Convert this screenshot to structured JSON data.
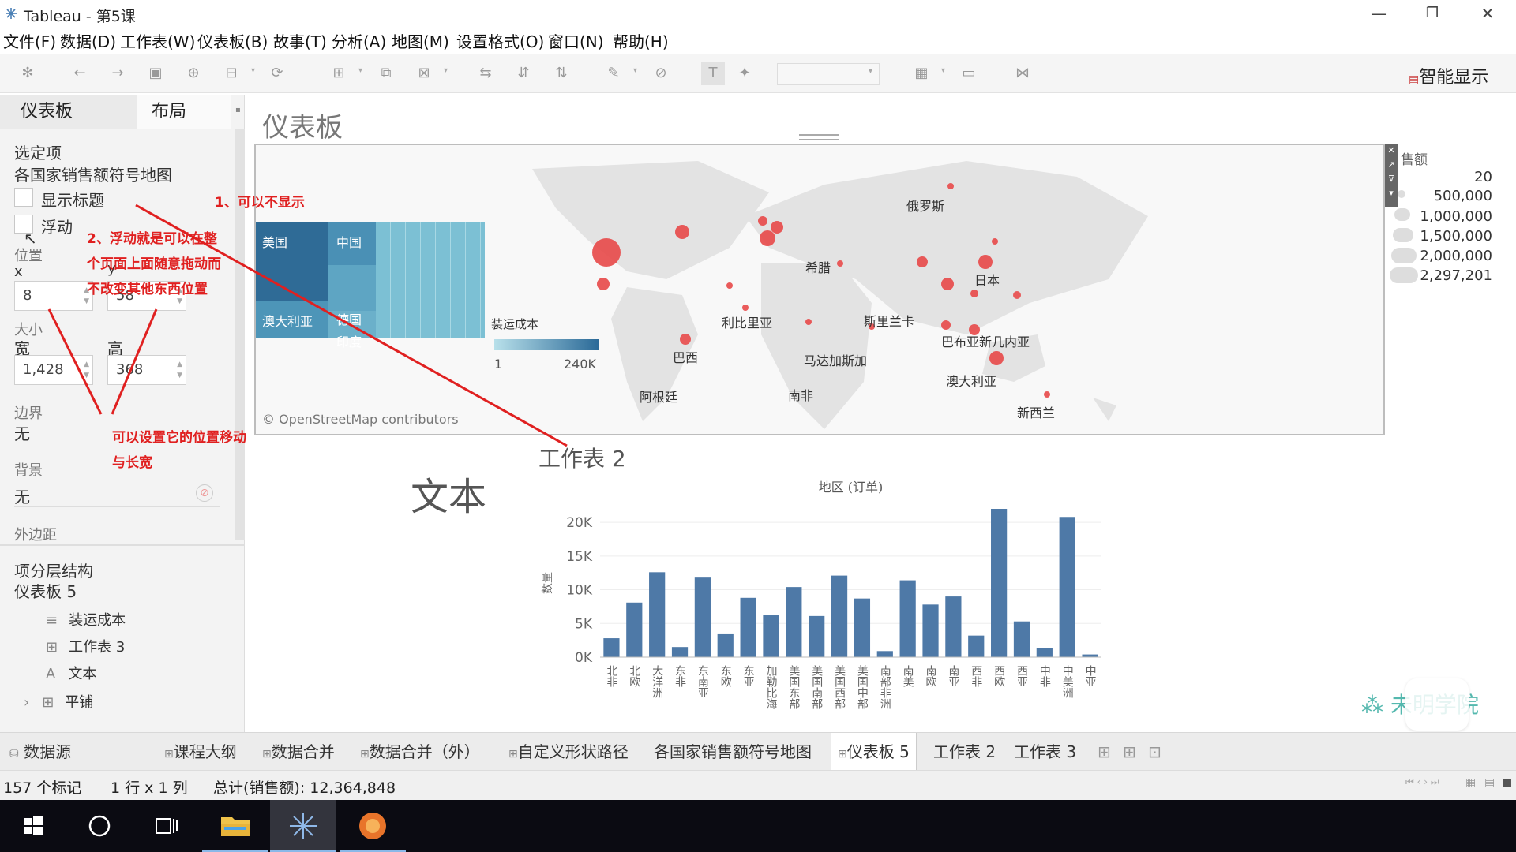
{
  "window": {
    "title": "Tableau - 第5课",
    "minimize": "—",
    "restore": "❐",
    "close": "✕"
  },
  "menu": [
    "文件(F)",
    "数据(D)",
    "工作表(W)",
    "仪表板(B)",
    "故事(T)",
    "分析(A)",
    "地图(M)",
    "设置格式(O)",
    "窗口(N)",
    "帮助(H)"
  ],
  "toolbar": {
    "smart_show": "智能显示"
  },
  "left_panel": {
    "tabs": [
      "仪表板",
      "布局"
    ],
    "selected_label": "选定项",
    "selected_item": "各国家销售额符号地图",
    "show_title": "显示标题",
    "floating": "浮动",
    "position_label": "位置",
    "x_label": "x",
    "y_label": "y",
    "x_value": "8",
    "y_value": "58",
    "size_label": "大小",
    "width_label": "宽",
    "height_label": "高",
    "width_value": "1,428",
    "height_value": "368",
    "border_label": "边界",
    "border_value": "无",
    "background_label": "背景",
    "background_value": "无",
    "margin_label": "外边距",
    "hierarchy_title": "项分层结构",
    "hierarchy_root": "仪表板 5",
    "hierarchy_items": [
      {
        "icon": "≡",
        "label": "装运成本"
      },
      {
        "icon": "⊞",
        "label": "工作表 3"
      },
      {
        "icon": "A",
        "label": "文本"
      },
      {
        "icon": "⊞",
        "label": "平铺"
      }
    ]
  },
  "dashboard": {
    "title": "仪表板",
    "worksheet2_title": "工作表 2",
    "text_object": "文本",
    "map": {
      "attribution": "© OpenStreetMap contributors",
      "country_labels": [
        "俄罗斯",
        "日本",
        "希腊",
        "利比里亚",
        "斯里兰卡",
        "巴布亚新几内亚",
        "巴西",
        "马达加斯加",
        "南非",
        "澳大利亚",
        "阿根廷",
        "新西兰"
      ],
      "treemap_labels": [
        "美国",
        "中国",
        "澳大利亚",
        "德国",
        "印度"
      ],
      "shipping_legend": {
        "title": "装运成本",
        "min": "1",
        "max": "240K"
      },
      "sales_legend": {
        "title": "售额",
        "items": [
          "20",
          "500,000",
          "1,000,000",
          "1,500,000",
          "2,000,000",
          "2,297,201"
        ]
      }
    }
  },
  "chart_data": {
    "type": "bar",
    "title": "地区 (订单)",
    "ylabel": "数量",
    "ylim": [
      0,
      22000
    ],
    "yticks": [
      "0K",
      "5K",
      "10K",
      "15K",
      "20K"
    ],
    "categories": [
      "北非",
      "北欧",
      "大洋洲",
      "东非",
      "东南亚",
      "东欧",
      "东亚",
      "加勒比海",
      "美国东部",
      "美国南部",
      "美国西部",
      "美国中部",
      "南部非洲",
      "南美",
      "南欧",
      "南亚",
      "西非",
      "西欧",
      "西亚",
      "中非",
      "中美洲",
      "中亚"
    ],
    "values": [
      2800,
      8100,
      12600,
      1500,
      11800,
      3400,
      8800,
      6200,
      10400,
      6100,
      12100,
      8700,
      900,
      11400,
      7800,
      9000,
      3200,
      22000,
      5300,
      1300,
      20800,
      400
    ],
    "color": "#4e79a7"
  },
  "sheet_tabs": [
    "数据源",
    "课程大纲",
    "数据合并",
    "数据合并（外）",
    "自定义形状路径",
    "各国家销售额符号地图",
    "仪表板 5",
    "工作表 2",
    "工作表 3"
  ],
  "status": {
    "marks": "157 个标记",
    "rows_cols": "1 行 x 1 列",
    "sum": "总计(销售额): 12,364,848"
  },
  "annotations": {
    "a1": "1、可以不显示",
    "a2_line1": "2、浮动就是可以在整",
    "a2_line2": "个页面上面随意拖动而",
    "a2_line3": "不改变其他东西位置",
    "a3_line1": "可以设置它的位置移动",
    "a3_line2": "与长宽"
  },
  "watermark": "未明学院",
  "colors": {
    "accent_red": "#e03a3a",
    "bar_blue": "#4e79a7",
    "treemap_dark": "#2f6b96",
    "treemap_light": "#6fb4cc"
  }
}
